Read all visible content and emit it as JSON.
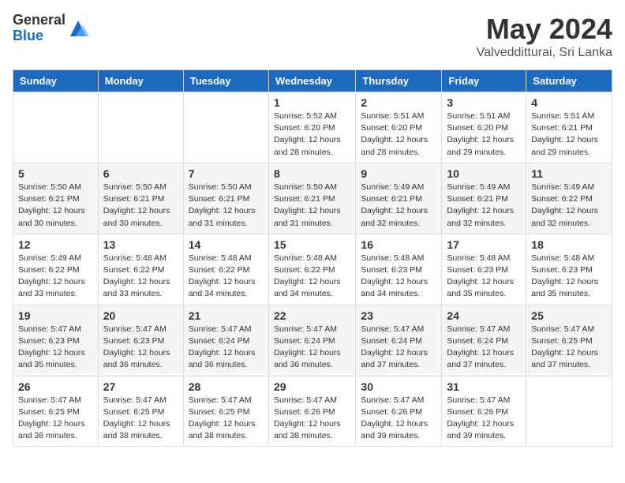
{
  "logo": {
    "general": "General",
    "blue": "Blue"
  },
  "title": "May 2024",
  "location": "Valvedditturai, Sri Lanka",
  "days_of_week": [
    "Sunday",
    "Monday",
    "Tuesday",
    "Wednesday",
    "Thursday",
    "Friday",
    "Saturday"
  ],
  "weeks": [
    [
      {
        "day": "",
        "info": ""
      },
      {
        "day": "",
        "info": ""
      },
      {
        "day": "",
        "info": ""
      },
      {
        "day": "1",
        "info": "Sunrise: 5:52 AM\nSunset: 6:20 PM\nDaylight: 12 hours and 28 minutes."
      },
      {
        "day": "2",
        "info": "Sunrise: 5:51 AM\nSunset: 6:20 PM\nDaylight: 12 hours and 28 minutes."
      },
      {
        "day": "3",
        "info": "Sunrise: 5:51 AM\nSunset: 6:20 PM\nDaylight: 12 hours and 29 minutes."
      },
      {
        "day": "4",
        "info": "Sunrise: 5:51 AM\nSunset: 6:21 PM\nDaylight: 12 hours and 29 minutes."
      }
    ],
    [
      {
        "day": "5",
        "info": "Sunrise: 5:50 AM\nSunset: 6:21 PM\nDaylight: 12 hours and 30 minutes."
      },
      {
        "day": "6",
        "info": "Sunrise: 5:50 AM\nSunset: 6:21 PM\nDaylight: 12 hours and 30 minutes."
      },
      {
        "day": "7",
        "info": "Sunrise: 5:50 AM\nSunset: 6:21 PM\nDaylight: 12 hours and 31 minutes."
      },
      {
        "day": "8",
        "info": "Sunrise: 5:50 AM\nSunset: 6:21 PM\nDaylight: 12 hours and 31 minutes."
      },
      {
        "day": "9",
        "info": "Sunrise: 5:49 AM\nSunset: 6:21 PM\nDaylight: 12 hours and 32 minutes."
      },
      {
        "day": "10",
        "info": "Sunrise: 5:49 AM\nSunset: 6:21 PM\nDaylight: 12 hours and 32 minutes."
      },
      {
        "day": "11",
        "info": "Sunrise: 5:49 AM\nSunset: 6:22 PM\nDaylight: 12 hours and 32 minutes."
      }
    ],
    [
      {
        "day": "12",
        "info": "Sunrise: 5:49 AM\nSunset: 6:22 PM\nDaylight: 12 hours and 33 minutes."
      },
      {
        "day": "13",
        "info": "Sunrise: 5:48 AM\nSunset: 6:22 PM\nDaylight: 12 hours and 33 minutes."
      },
      {
        "day": "14",
        "info": "Sunrise: 5:48 AM\nSunset: 6:22 PM\nDaylight: 12 hours and 34 minutes."
      },
      {
        "day": "15",
        "info": "Sunrise: 5:48 AM\nSunset: 6:22 PM\nDaylight: 12 hours and 34 minutes."
      },
      {
        "day": "16",
        "info": "Sunrise: 5:48 AM\nSunset: 6:23 PM\nDaylight: 12 hours and 34 minutes."
      },
      {
        "day": "17",
        "info": "Sunrise: 5:48 AM\nSunset: 6:23 PM\nDaylight: 12 hours and 35 minutes."
      },
      {
        "day": "18",
        "info": "Sunrise: 5:48 AM\nSunset: 6:23 PM\nDaylight: 12 hours and 35 minutes."
      }
    ],
    [
      {
        "day": "19",
        "info": "Sunrise: 5:47 AM\nSunset: 6:23 PM\nDaylight: 12 hours and 35 minutes."
      },
      {
        "day": "20",
        "info": "Sunrise: 5:47 AM\nSunset: 6:23 PM\nDaylight: 12 hours and 36 minutes."
      },
      {
        "day": "21",
        "info": "Sunrise: 5:47 AM\nSunset: 6:24 PM\nDaylight: 12 hours and 36 minutes."
      },
      {
        "day": "22",
        "info": "Sunrise: 5:47 AM\nSunset: 6:24 PM\nDaylight: 12 hours and 36 minutes."
      },
      {
        "day": "23",
        "info": "Sunrise: 5:47 AM\nSunset: 6:24 PM\nDaylight: 12 hours and 37 minutes."
      },
      {
        "day": "24",
        "info": "Sunrise: 5:47 AM\nSunset: 6:24 PM\nDaylight: 12 hours and 37 minutes."
      },
      {
        "day": "25",
        "info": "Sunrise: 5:47 AM\nSunset: 6:25 PM\nDaylight: 12 hours and 37 minutes."
      }
    ],
    [
      {
        "day": "26",
        "info": "Sunrise: 5:47 AM\nSunset: 6:25 PM\nDaylight: 12 hours and 38 minutes."
      },
      {
        "day": "27",
        "info": "Sunrise: 5:47 AM\nSunset: 6:25 PM\nDaylight: 12 hours and 38 minutes."
      },
      {
        "day": "28",
        "info": "Sunrise: 5:47 AM\nSunset: 6:25 PM\nDaylight: 12 hours and 38 minutes."
      },
      {
        "day": "29",
        "info": "Sunrise: 5:47 AM\nSunset: 6:26 PM\nDaylight: 12 hours and 38 minutes."
      },
      {
        "day": "30",
        "info": "Sunrise: 5:47 AM\nSunset: 6:26 PM\nDaylight: 12 hours and 39 minutes."
      },
      {
        "day": "31",
        "info": "Sunrise: 5:47 AM\nSunset: 6:26 PM\nDaylight: 12 hours and 39 minutes."
      },
      {
        "day": "",
        "info": ""
      }
    ]
  ]
}
